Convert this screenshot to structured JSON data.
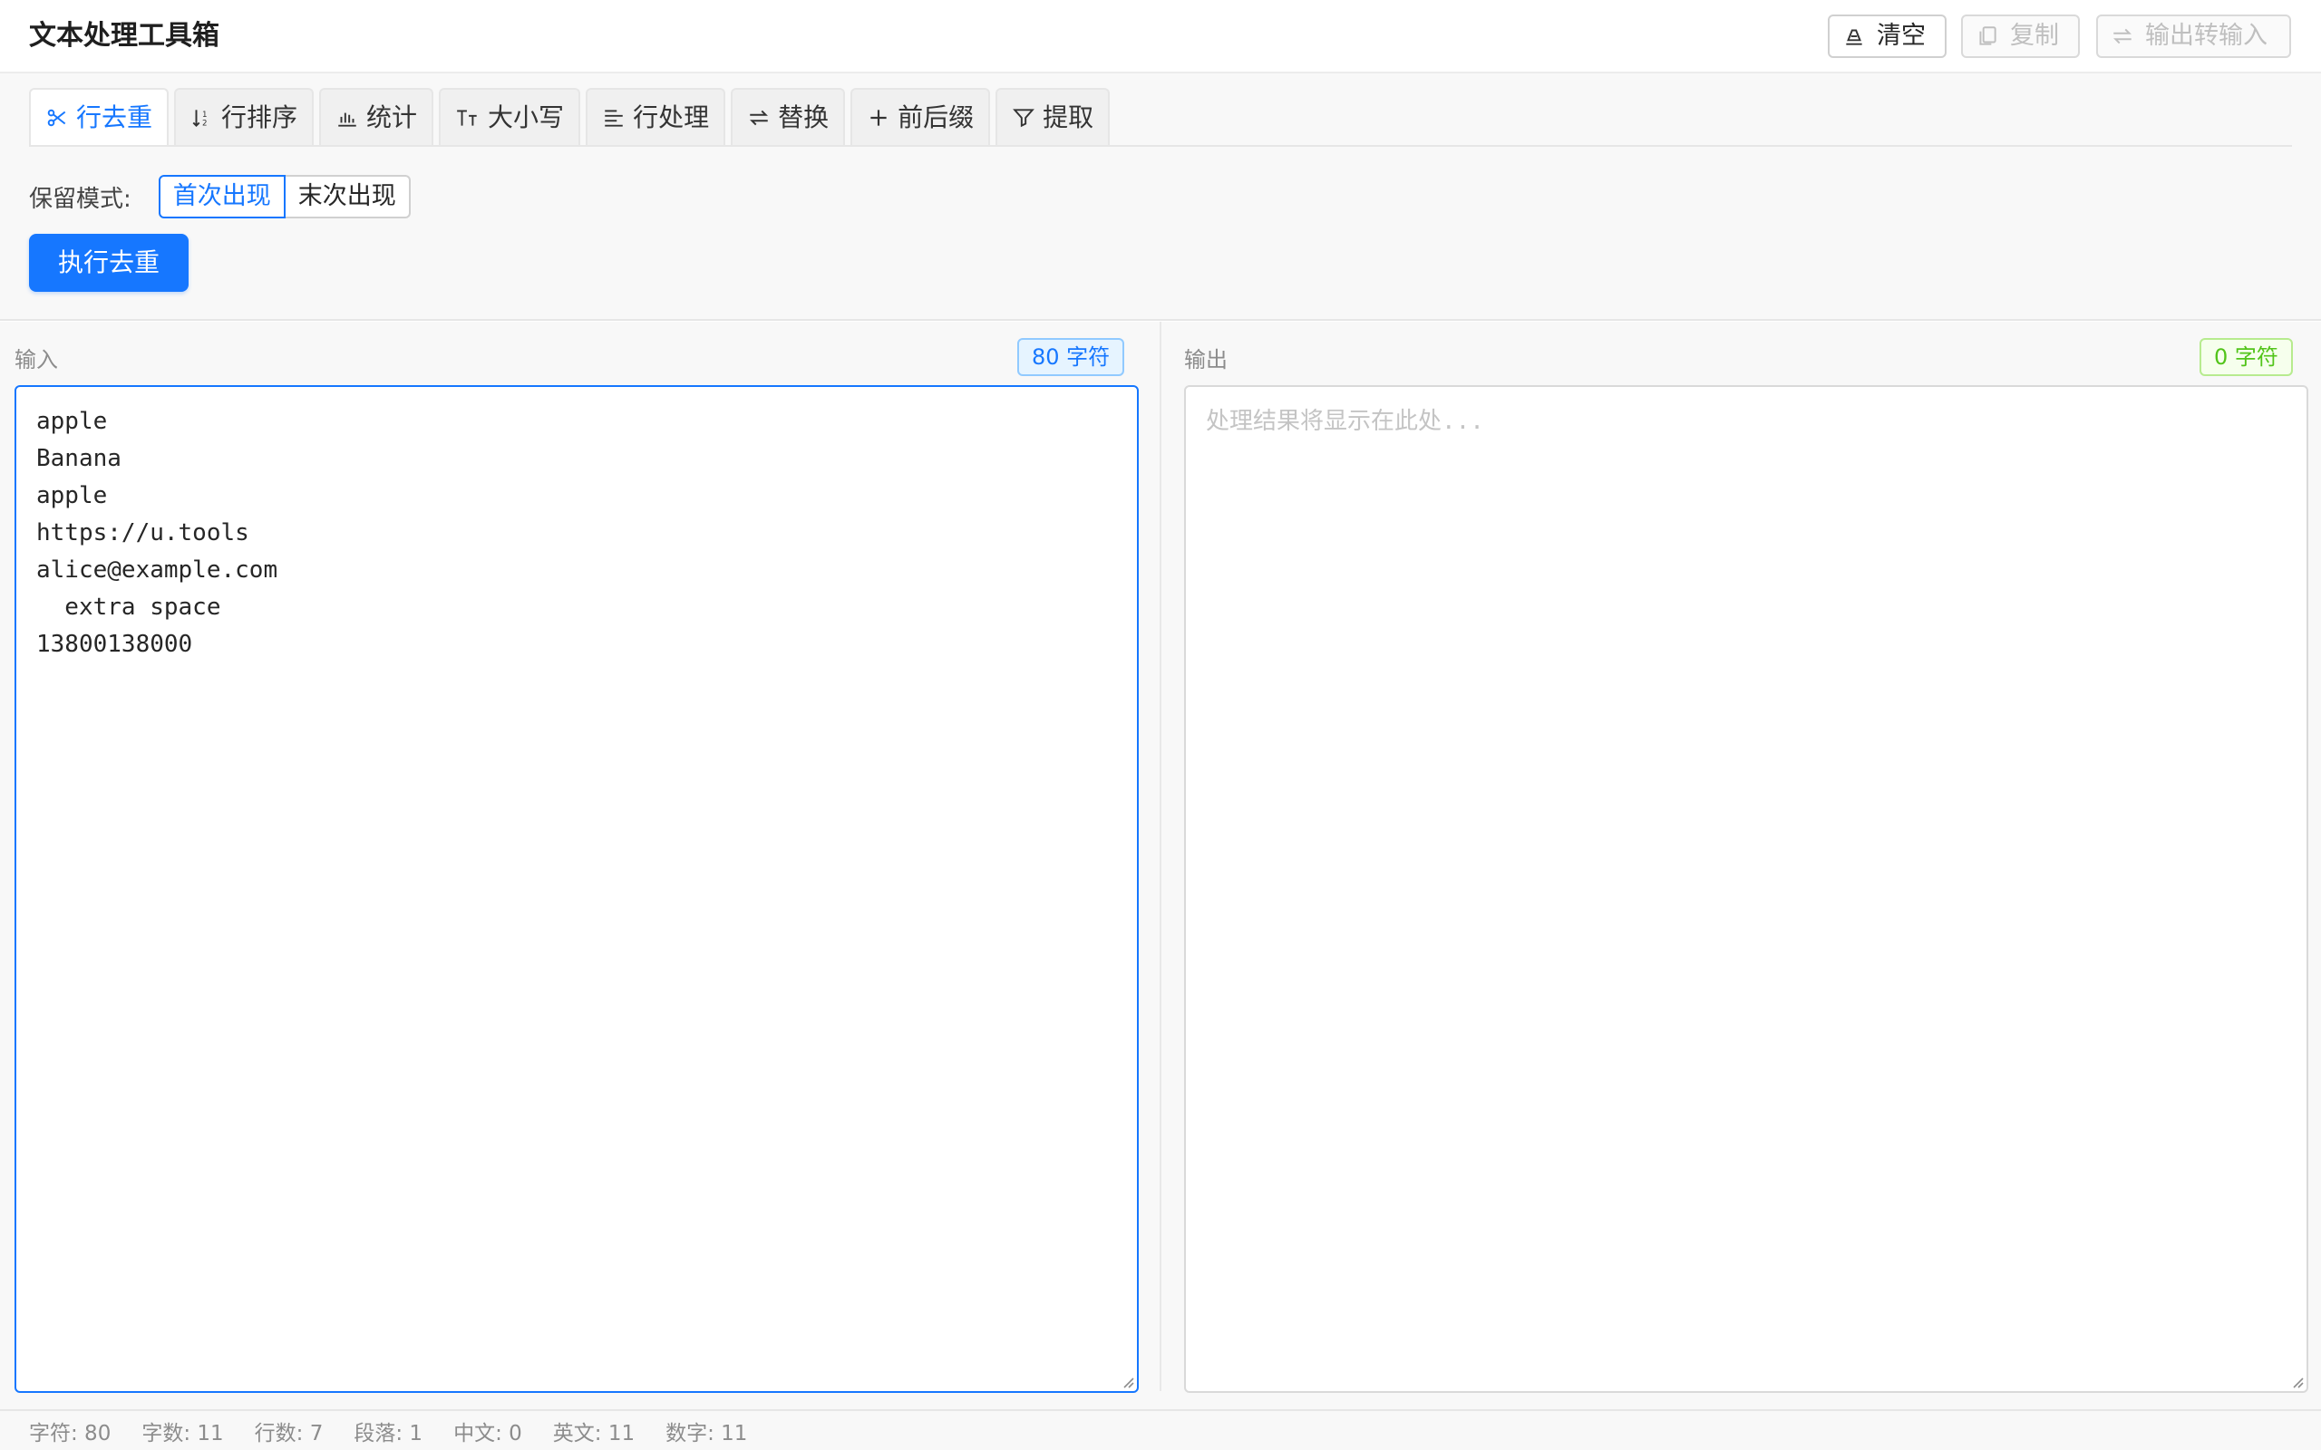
{
  "header": {
    "title": "文本处理工具箱",
    "buttons": [
      {
        "label": "清空",
        "icon": "eraser-icon",
        "disabled": false
      },
      {
        "label": "复制",
        "icon": "copy-icon",
        "disabled": true
      },
      {
        "label": "输出转输入",
        "icon": "swap-icon",
        "disabled": true
      }
    ]
  },
  "tabs": [
    {
      "label": "行去重",
      "icon": "scissors-icon",
      "active": true
    },
    {
      "label": "行排序",
      "icon": "sort-icon",
      "active": false
    },
    {
      "label": "统计",
      "icon": "bar-chart-icon",
      "active": false
    },
    {
      "label": "大小写",
      "icon": "font-case-icon",
      "active": false
    },
    {
      "label": "行处理",
      "icon": "align-lines-icon",
      "active": false
    },
    {
      "label": "替换",
      "icon": "swap-icon",
      "active": false
    },
    {
      "label": "前后缀",
      "icon": "plus-icon",
      "active": false
    },
    {
      "label": "提取",
      "icon": "filter-icon",
      "active": false
    }
  ],
  "dedupe": {
    "mode_label": "保留模式:",
    "modes": [
      "首次出现",
      "末次出现"
    ],
    "selected_mode": "首次出现",
    "execute_label": "执行去重"
  },
  "input": {
    "label": "输入",
    "char_badge": "80 字符",
    "value": "apple\nBanana\napple\nhttps://u.tools\nalice@example.com\n  extra space\n13800138000"
  },
  "output": {
    "label": "输出",
    "char_badge": "0 字符",
    "placeholder": "处理结果将显示在此处...",
    "value": ""
  },
  "stats": [
    "字符: 80",
    "字数: 11",
    "行数: 7",
    "段落: 1",
    "中文: 0",
    "英文: 11",
    "数字: 11"
  ],
  "colors": {
    "accent": "#1677ff",
    "success": "#52c41a",
    "disabled": "#bfbfbf"
  }
}
